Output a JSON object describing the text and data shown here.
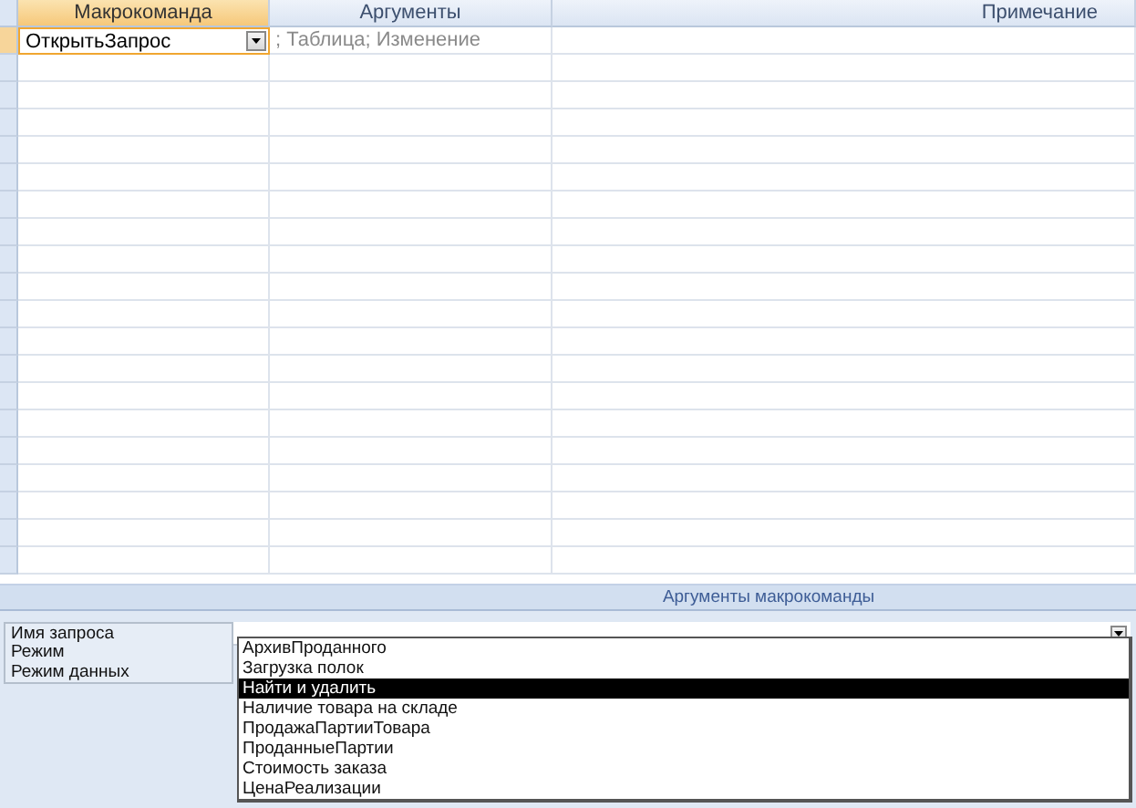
{
  "grid": {
    "columns": [
      {
        "label": "Макрокоманда",
        "selected": true
      },
      {
        "label": "Аргументы",
        "selected": false
      },
      {
        "label": "Примечание",
        "selected": false
      }
    ],
    "rows": [
      {
        "action": "ОткрытьЗапрос",
        "arguments": "; Таблица; Изменение",
        "selected": true
      }
    ]
  },
  "arguments_panel": {
    "title": "Аргументы макрокоманды",
    "fields": [
      {
        "label": "Имя запроса",
        "options": [
          {
            "label": "АрхивПроданного",
            "selected": false
          },
          {
            "label": "Загрузка полок",
            "selected": false
          },
          {
            "label": "Найти и удалить",
            "selected": true
          },
          {
            "label": "Наличие товара на складе",
            "selected": false
          },
          {
            "label": "ПродажаПартииТовара",
            "selected": false
          },
          {
            "label": "ПроданныеПартии",
            "selected": false
          },
          {
            "label": "Стоимость  заказа",
            "selected": false
          },
          {
            "label": "ЦенаРеализации",
            "selected": false
          }
        ]
      },
      {
        "label": "Режим"
      },
      {
        "label": "Режим данных"
      }
    ]
  }
}
